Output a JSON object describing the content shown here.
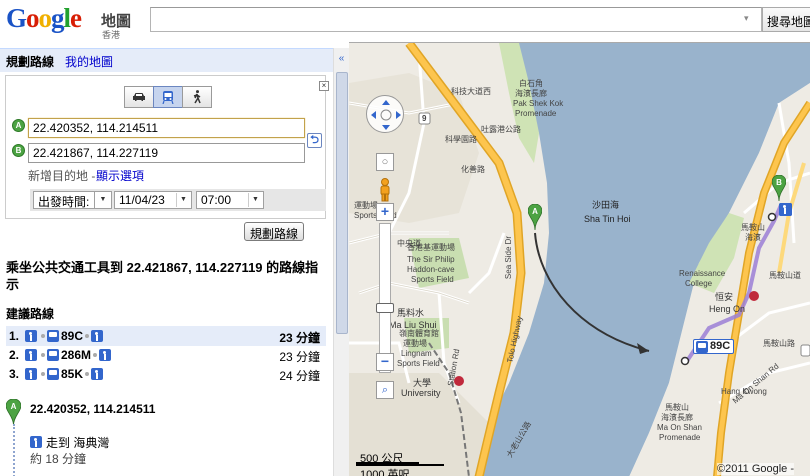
{
  "header": {
    "logo_text": "Google",
    "logo_maps": "地圖",
    "logo_region": "香港",
    "search_value": "",
    "search_button": "搜尋地圖"
  },
  "topbar": {
    "plan_route": "規劃路線",
    "my_maps": "我的地圖"
  },
  "directions": {
    "close": "×",
    "modes": [
      "car-icon",
      "transit-icon",
      "walk-icon"
    ],
    "active_mode": "transit",
    "waypoint_a_label": "A",
    "waypoint_a": "22.420352, 114.214511",
    "waypoint_b_label": "B",
    "waypoint_b": "22.421867, 114.227119",
    "add_destination": "新增目的地",
    "separator": " - ",
    "show_options": "顯示選項",
    "time_type": "出發時間:",
    "date": "11/04/23",
    "time": "07:00",
    "plan_button": "規劃路線"
  },
  "results": {
    "title": "乘坐公共交通工具到 22.421867, 114.227119 的路線指示",
    "suggested_title": "建議路線",
    "routes": [
      {
        "num": "1.",
        "bus": "89C",
        "time": "23 分鐘"
      },
      {
        "num": "2.",
        "bus": "286M",
        "time": "23 分鐘"
      },
      {
        "num": "3.",
        "bus": "85K",
        "time": "24 分鐘"
      }
    ],
    "start_label": "A",
    "start": "22.420352, 114.214511",
    "step1": "走到 海典灣",
    "step1_duration": "約 18 分鐘"
  },
  "map": {
    "labels": {
      "kowloon_lo": "科技大道西",
      "science_park_rd": "科學園路",
      "pak_shek_kok": "白石角",
      "pak_shek_kok_promenade": "海濱長廊",
      "pak_shek_kok_en": "Pak Shek Kok",
      "promenade_en": "Promenade",
      "fo_yin_rd": "化善路",
      "tolo_hwy_cjk": "吐露港公路",
      "sha_tin_hoi": "沙田海",
      "sha_tin_hoi_en": "Sha Tin Hoi",
      "sports_field": "運動場",
      "sports_field_en": "Sports Field",
      "sir_philip": "香港基運動場",
      "sir_philip_en1": "The Sir Philip",
      "sir_philip_en2": "Haddon-cave",
      "sir_philip_en3": "Sports Field",
      "central_ave": "中央道",
      "ma_liu_shui": "馬料水",
      "ma_liu_shui_en": "Ma Liu Shui",
      "lingnan": "嶺南體育館",
      "lingnan2": "運動場",
      "lingnan_en1": "Lingnam",
      "lingnan_en2": "Sports Field",
      "university": "大學",
      "university_en": "University",
      "station_rd": "Station Rd",
      "sea_side_dr": "Sea Side Dr",
      "tolo_highway_en": "Tolo Highway",
      "tai_po_rd": "大老山公路",
      "renaissance": "Renaissance",
      "college": "College",
      "hang_on": "恒安",
      "hang_on_en": "Heng On",
      "ma_on_shan_promenade": "馬鞍山",
      "ma_on_shan_promenade2": "海濱長廊",
      "ma_on_shan_en": "Ma On Shan",
      "promenade_en2": "Promenade",
      "ma_on_shan_rd": "馬鞍山路",
      "ma_on_shan_rd_en": "Ma On Shan Rd",
      "ma_on_shan_top": "馬鞍山",
      "ma_on_shan_top2": "海濱",
      "ma_on_shan_right": "馬鞍山道",
      "hang_kwong": "Hang Kwong",
      "highway_9": "9"
    },
    "bus_badge": "89C",
    "pin_a": "A",
    "pin_b": "B",
    "scale_top": "500 公尺",
    "scale_bottom": "1000 英呎",
    "copyright": "©2011 Google -"
  },
  "collapse": "«"
}
